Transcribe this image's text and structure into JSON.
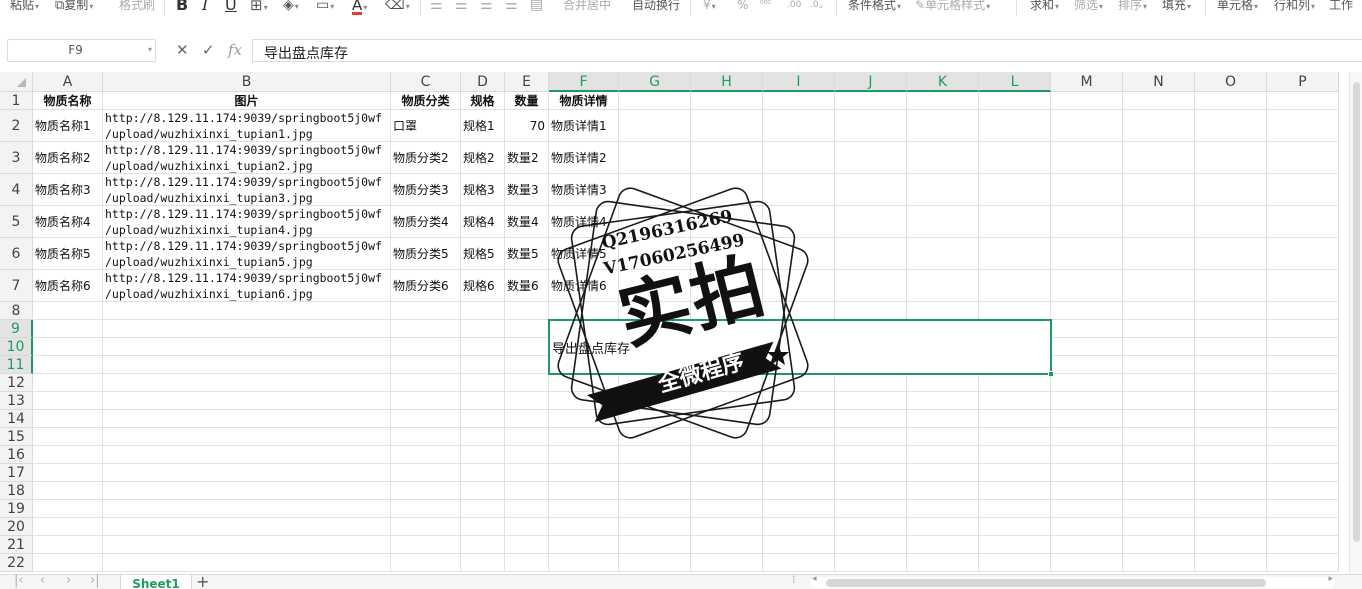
{
  "toolbar": {
    "paste": "粘贴",
    "copy": "复制",
    "format_painter": "格式刷",
    "bold": "B",
    "italic": "I",
    "underline": "U",
    "font_color_glyph": "A",
    "merge_center": "合并居中",
    "wrap_text": "自动换行",
    "currency_glyph": "¥",
    "percent_glyph": "%",
    "conditional_format": "条件格式",
    "cell_style": "单元格样式",
    "sum": "求和",
    "filter": "筛选",
    "sort": "排序",
    "fill": "填充",
    "cell": "单元格",
    "row_col": "行和列",
    "worksheet": "工作"
  },
  "formula_bar": {
    "name_box": "F9",
    "fx": "fx",
    "value": "导出盘点库存"
  },
  "columns": [
    "A",
    "B",
    "C",
    "D",
    "E",
    "F",
    "G",
    "H",
    "I",
    "J",
    "K",
    "L",
    "M",
    "N",
    "O",
    "P"
  ],
  "rows": [
    "1",
    "2",
    "3",
    "4",
    "5",
    "6",
    "7",
    "8",
    "9",
    "10",
    "11",
    "12",
    "13",
    "14",
    "15",
    "16",
    "17",
    "18",
    "19",
    "20",
    "21",
    "22"
  ],
  "header_row": [
    "物质名称",
    "图片",
    "物质分类",
    "规格",
    "数量",
    "物质详情"
  ],
  "data_rows": [
    {
      "name": "物质名称1",
      "url": "http://8.129.11.174:9039/springboot5j0wf\n/upload/wuzhixinxi_tupian1.jpg",
      "category": "口罩",
      "spec": "规格1",
      "qty": "70",
      "detail": "物质详情1"
    },
    {
      "name": "物质名称2",
      "url": "http://8.129.11.174:9039/springboot5j0wf\n/upload/wuzhixinxi_tupian2.jpg",
      "category": "物质分类2",
      "spec": "规格2",
      "qty": "数量2",
      "detail": "物质详情2"
    },
    {
      "name": "物质名称3",
      "url": "http://8.129.11.174:9039/springboot5j0wf\n/upload/wuzhixinxi_tupian3.jpg",
      "category": "物质分类3",
      "spec": "规格3",
      "qty": "数量3",
      "detail": "物质详情3"
    },
    {
      "name": "物质名称4",
      "url": "http://8.129.11.174:9039/springboot5j0wf\n/upload/wuzhixinxi_tupian4.jpg",
      "category": "物质分类4",
      "spec": "规格4",
      "qty": "数量4",
      "detail": "物质详情4"
    },
    {
      "name": "物质名称5",
      "url": "http://8.129.11.174:9039/springboot5j0wf\n/upload/wuzhixinxi_tupian5.jpg",
      "category": "物质分类5",
      "spec": "规格5",
      "qty": "数量5",
      "detail": "物质详情5"
    },
    {
      "name": "物质名称6",
      "url": "http://8.129.11.174:9039/springboot5j0wf\n/upload/wuzhixinxi_tupian6.jpg",
      "category": "物质分类6",
      "spec": "规格6",
      "qty": "数量6",
      "detail": "物质详情6"
    }
  ],
  "merged_cell_text": "导出盘点库存",
  "sheet_tab": "Sheet1",
  "add_sheet_glyph": "+",
  "watermark": {
    "contact_1": "Q2196316269",
    "contact_2": "V17060256499",
    "main": "实拍",
    "banner": "全微程序"
  },
  "colors": {
    "accent": "#1f9b62",
    "font_color_swatch": "#e03c31"
  }
}
